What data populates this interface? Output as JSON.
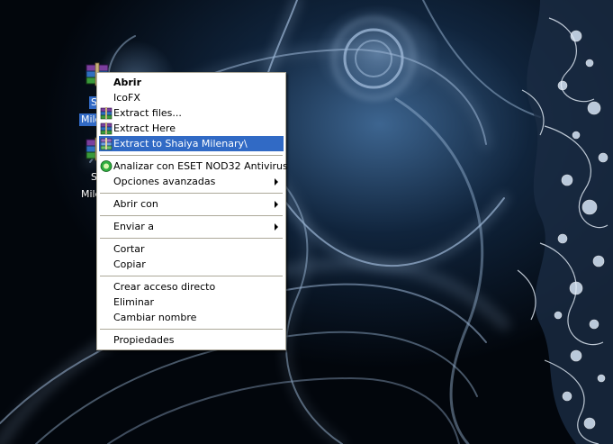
{
  "desktop": {
    "icons": [
      {
        "label_line1": "Sh",
        "label_line2": "Milena",
        "selected": true,
        "icon": "winrar-archive-icon"
      },
      {
        "label_line1": "Sh",
        "label_line2": "Milena",
        "selected": false,
        "icon": "winrar-archive-icon"
      }
    ]
  },
  "context_menu": {
    "items": [
      {
        "label": "Abrir",
        "bold": true
      },
      {
        "label": "IcoFX"
      },
      {
        "label": "Extract files...",
        "icon": "winrar-icon"
      },
      {
        "label": "Extract Here",
        "icon": "winrar-icon"
      },
      {
        "label": "Extract to Shaiya Milenary\\",
        "icon": "winrar-icon",
        "highlighted": true
      },
      {
        "label": "Analizar con ESET NOD32 Antivirus",
        "icon": "eset-icon"
      },
      {
        "label": "Opciones avanzadas",
        "submenu": true
      },
      {
        "label": "Abrir con",
        "submenu": true
      },
      {
        "label": "Enviar a",
        "submenu": true
      },
      {
        "label": "Cortar"
      },
      {
        "label": "Copiar"
      },
      {
        "label": "Crear acceso directo"
      },
      {
        "label": "Eliminar"
      },
      {
        "label": "Cambiar nombre"
      },
      {
        "label": "Propiedades"
      }
    ]
  },
  "colors": {
    "highlight": "#316ac5",
    "menu_border": "#aca899",
    "desktop_bg": "#02060c"
  }
}
